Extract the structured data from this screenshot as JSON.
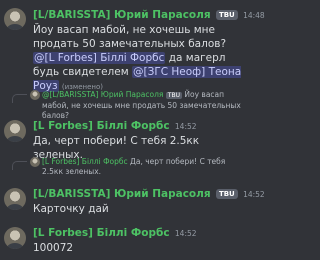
{
  "messages": [
    {
      "author": "[L/BARISSTA] Юрий Парасоля",
      "badge": "TBU",
      "time": "14:48",
      "text_before": "Йоу васап мабой, не хочешь мне продать 50 замечательных балов?",
      "mention1": "@[L Forbes] Біллі Форбс",
      "text_middle": "да магерл будь свидетелем",
      "mention2": "@[ЗГС Неоф] Теона Роуз",
      "edited": "(изменено)"
    },
    {
      "reply_author": "@[L/BARISSTA] Юрий Парасоля",
      "reply_badge": "TBU",
      "reply_text": "Йоу васап мабой, не хочешь мне продать 50 замечательных балов?",
      "author": "[L Forbes] Біллі Форбс",
      "time": "14:52",
      "text": "Да, черт побери! С тебя 2.5кк зеленых."
    },
    {
      "reply_author": "[L Forbes] Біллі Форбс",
      "reply_text": "Да, черт побери! С тебя 2.5кк зеленых.",
      "author": "[L/BARISSTA] Юрий Парасоля",
      "badge": "TBU",
      "time": "14:52",
      "text": "Карточку дай"
    },
    {
      "author": "[L Forbes] Біллі Форбс",
      "time": "14:52",
      "text": "100072"
    }
  ]
}
